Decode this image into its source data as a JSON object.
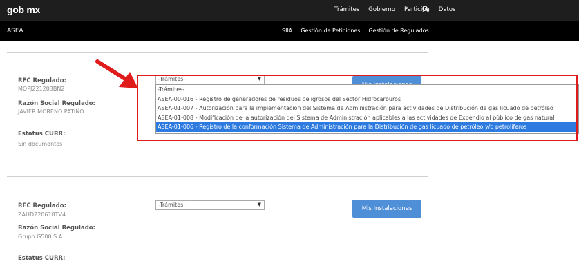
{
  "header": {
    "logo": "gob mx",
    "nav": [
      "Trámites",
      "Gobierno",
      "Participa",
      "Datos"
    ],
    "search_icon": "search-icon"
  },
  "subheader": {
    "brand": "ASEA",
    "nav": [
      "SIIA",
      "Gestión de Peticiones",
      "Gestión de Regulados"
    ]
  },
  "records": [
    {
      "rfc_label": "RFC Regulado:",
      "rfc_value": "MOPJ221203BN2",
      "razon_label": "Razón Social Regulado:",
      "razon_value": "JAVIER MORENO PATIÑO",
      "estatus_label": "Estatus CURR:",
      "estatus_value": "Sin documentos",
      "select_value": "-Trámites-",
      "button_label": "Mis Instalaciones"
    },
    {
      "rfc_label": "RFC Regulado:",
      "rfc_value": "ZAHD220618TV4",
      "razon_label": "Razón Social Regulado:",
      "razon_value": "Grupo G500 S.A",
      "estatus_label": "Estatus CURR:",
      "select_value": "-Trámites-",
      "button_label": "Mis Instalaciones"
    }
  ],
  "dropdown": {
    "options": [
      "-Trámites-",
      "ASEA-00-016 - Registro de generadores de residuos peligrosos del Sector Hidrocarburos",
      "ASEA-01-007 - Autorización para la implementación del Sistema de Administración para actividades de Distribución de gas licuado de petróleo",
      "ASEA-01-008 - Modificación de la autorización del Sistema de Administración aplicables a las actividades de Expendio al público de gas natural",
      "ASEA-01-006 - Registro de la conformación Sistema de Administración para la Distribución de gas licuado de petróleo y/o petrolíferos"
    ],
    "selected_index": 4
  },
  "colors": {
    "topbar": "#1e1e1e",
    "subbar": "#000000",
    "button": "#4f8fd7",
    "selected_option": "#2d7be0",
    "annotation": "#e01b1b"
  }
}
